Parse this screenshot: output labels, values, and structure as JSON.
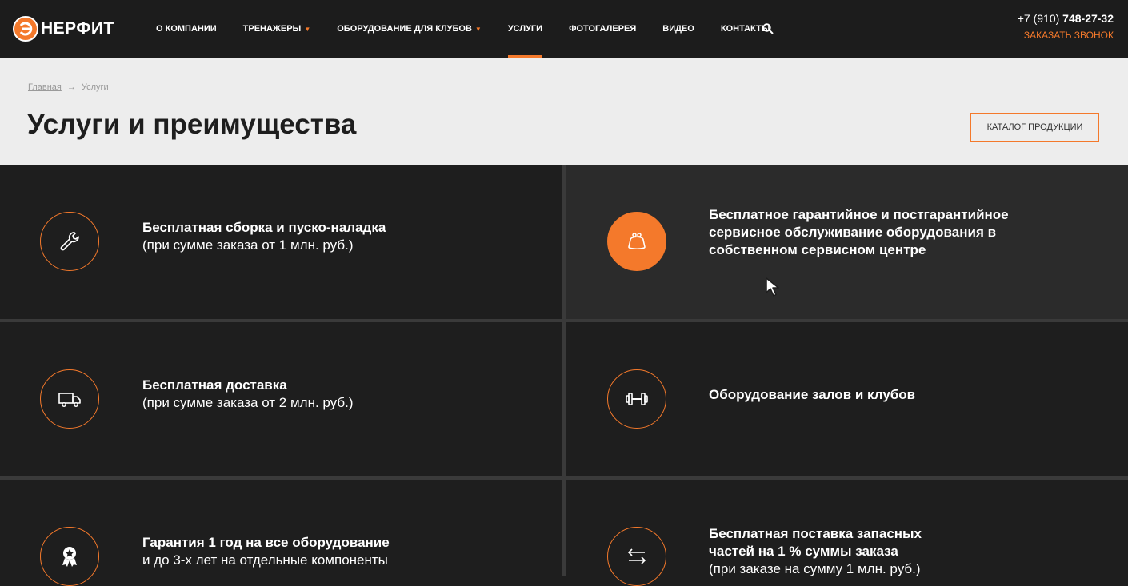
{
  "header": {
    "logo_text": "НЕРФИТ",
    "nav": [
      {
        "label": "О КОМПАНИИ",
        "caret": false,
        "active": false
      },
      {
        "label": "ТРЕНАЖЕРЫ",
        "caret": true,
        "active": false
      },
      {
        "label": "ОБОРУДОВАНИЕ ДЛЯ КЛУБОВ",
        "caret": true,
        "active": false
      },
      {
        "label": "УСЛУГИ",
        "caret": false,
        "active": true
      },
      {
        "label": "ФОТОГАЛЕРЕЯ",
        "caret": false,
        "active": false
      },
      {
        "label": "ВИДЕО",
        "caret": false,
        "active": false
      },
      {
        "label": "КОНТАКТЫ",
        "caret": false,
        "active": false
      }
    ],
    "phone_prefix": "+7 (910) ",
    "phone_number": "748-27-32",
    "callback_label": "ЗАКАЗАТЬ ЗВОНОК"
  },
  "hero": {
    "breadcrumb_home": "Главная",
    "breadcrumb_arrow": "→",
    "breadcrumb_current": "Услуги",
    "title": "Услуги и преимущества",
    "catalog_button": "КАТАЛОГ ПРОДУКЦИИ"
  },
  "services": [
    {
      "icon": "wrench-icon",
      "title": "Бесплатная сборка и пуско-наладка",
      "sub": "(при сумме заказа от 1 млн. руб.)"
    },
    {
      "icon": "purse-icon",
      "title": "Бесплатное гарантийное и постгарантийное сервисное обслуживание оборудования в собственном сервисном центре",
      "sub": ""
    },
    {
      "icon": "truck-icon",
      "title": "Бесплатная доставка",
      "sub": "(при сумме заказа от 2 млн. руб.)"
    },
    {
      "icon": "dumbbell-icon",
      "title": "Оборудование залов и клубов",
      "sub": ""
    },
    {
      "icon": "award-icon",
      "title": "Гарантия 1 год на все оборудование",
      "sub": "и до 3-х лет на отдельные компоненты"
    },
    {
      "icon": "exchange-icon",
      "title": "Бесплатная поставка запасных частей на 1 % суммы заказа",
      "sub": "(при заказе на сумму 1 млн. руб.)"
    }
  ],
  "colors": {
    "accent": "#f4792b",
    "dark": "#1e1e1e",
    "hero_bg": "#ededed"
  }
}
